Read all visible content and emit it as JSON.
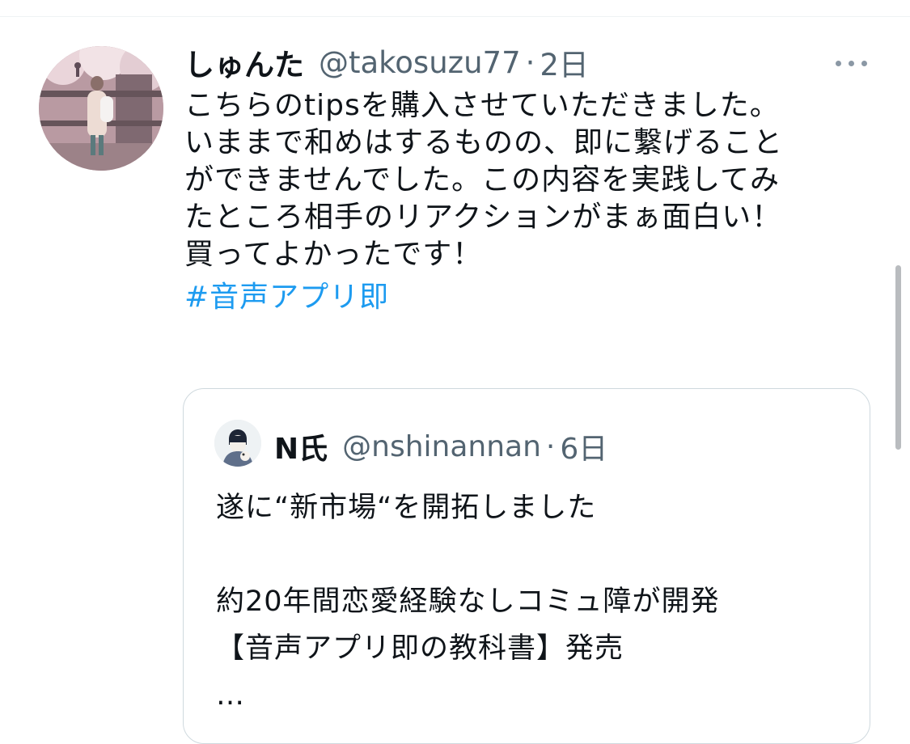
{
  "tweet": {
    "author_name": "しゅんた",
    "handle": "@takosuzu77",
    "separator": "·",
    "time": "2日",
    "lines": [
      "こちらのtipsを購入させていただきました。",
      "いままで和めはするものの、即に繋げること",
      "ができませんでした。この内容を実践してみ",
      "たところ相手のリアクションがまぁ面白い！",
      "買ってよかったです！"
    ],
    "hashtag": "#音声アプリ即",
    "more_icon": "more-horizontal-icon"
  },
  "quote": {
    "author_name": "N氏",
    "handle": "@nshinannan",
    "separator": "·",
    "time": "6日",
    "lines": [
      "遂に“新市場“を開拓しました",
      "",
      "約20年間恋愛経験なしコミュ障が開発",
      "【音声アプリ即の教科書】発売",
      "…"
    ]
  },
  "colors": {
    "text": "#0f1419",
    "secondary": "#536471",
    "link": "#1d9bf0",
    "border": "#cfd9de"
  }
}
